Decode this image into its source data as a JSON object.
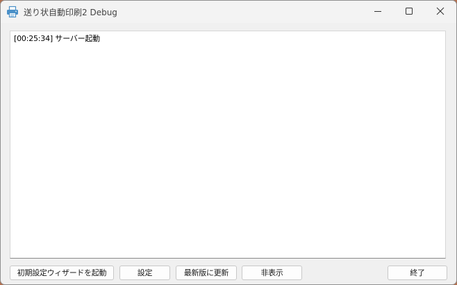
{
  "window": {
    "title": "送り状自動印刷2 Debug"
  },
  "log": {
    "lines": [
      "[00:25:34] サーバー起動"
    ]
  },
  "buttons": {
    "setup_wizard": "初期設定ウィザードを起動",
    "settings": "設定",
    "update": "最新版に更新",
    "hide": "非表示",
    "exit": "終了"
  },
  "icons": {
    "app": "printer-icon",
    "minimize": "minimize-icon",
    "maximize": "maximize-icon",
    "close": "close-icon"
  },
  "colors": {
    "app_icon": "#4a90c8",
    "window_bg": "#f0f0f0",
    "log_bg": "#ffffff"
  }
}
